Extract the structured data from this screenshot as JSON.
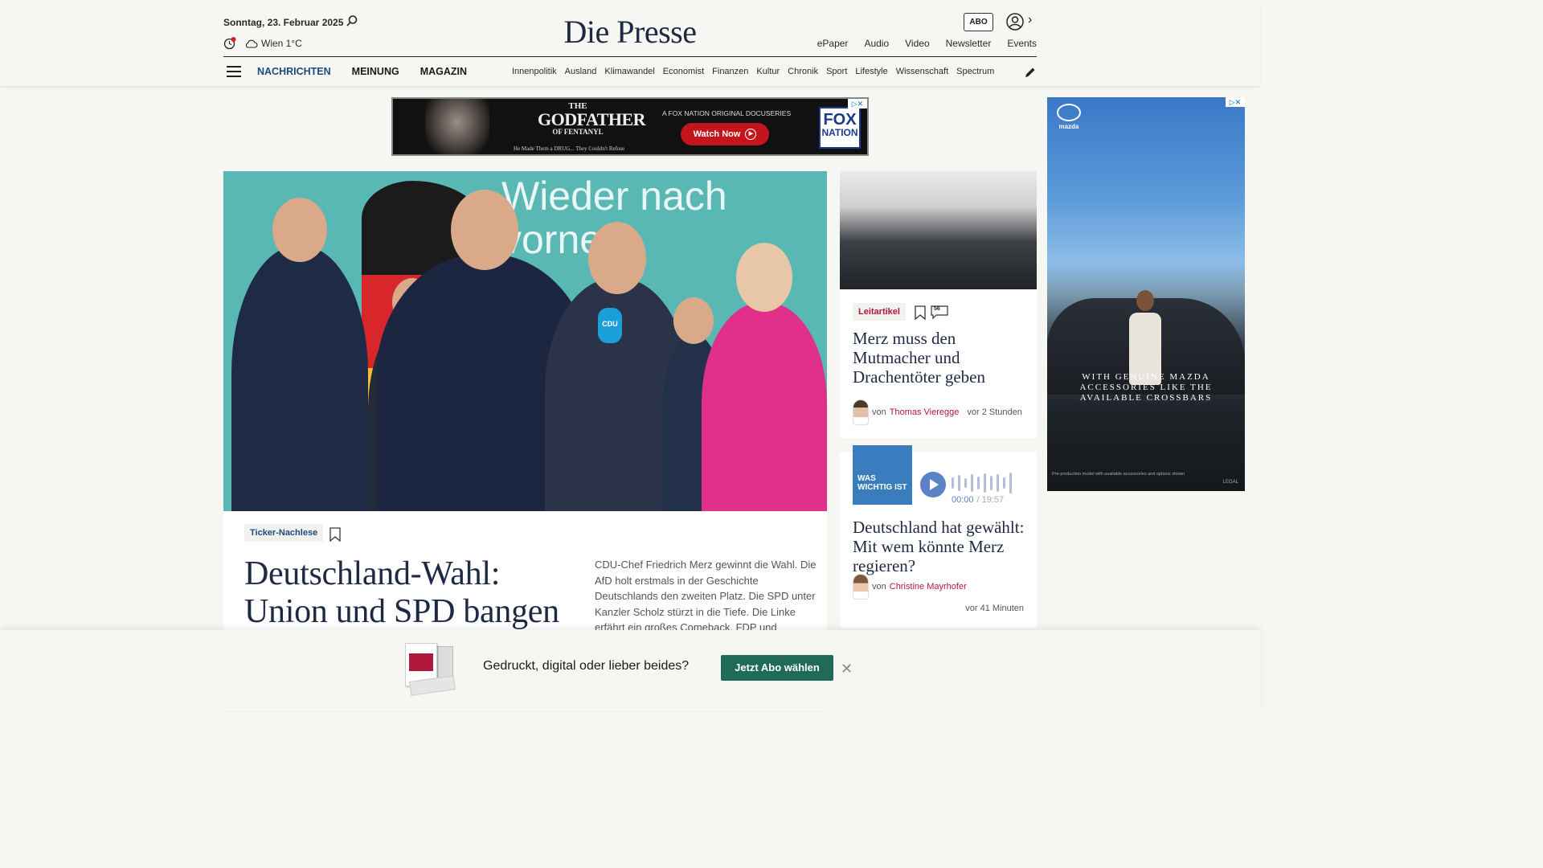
{
  "header": {
    "date": "Sonntag, 23. Februar 2025",
    "weather": "Wien 1°C",
    "logo": "Die Presse",
    "abo": "ABO",
    "top_links": [
      "ePaper",
      "Audio",
      "Video",
      "Newsletter",
      "Events"
    ]
  },
  "nav": {
    "main": [
      "NACHRICHTEN",
      "MEINUNG",
      "MAGAZIN"
    ],
    "sub": [
      "Innenpolitik",
      "Ausland",
      "Klimawandel",
      "Economist",
      "Finanzen",
      "Kultur",
      "Chronik",
      "Sport",
      "Lifestyle",
      "Wissenschaft",
      "Spectrum"
    ]
  },
  "ad_top": {
    "title_l1": "THE",
    "title_l2": "GODFATHER",
    "title_l3": "OF FENTANYL",
    "tagline": "He Made Them a DRUG... They Couldn't Refuse",
    "subtitle": "A FOX NATION ORIGINAL DOCUSERIES",
    "cta": "Watch Now",
    "brand_l1": "FOX",
    "brand_l2": "NATION"
  },
  "ad_side": {
    "brand": "mazda",
    "headline": "WITH GENUINE MAZDA ACCESSORIES LIKE THE AVAILABLE CROSSBARS",
    "fine_print": "Pre-production model with available accessories and options shown",
    "legal": "LEGAL"
  },
  "hero": {
    "image_text": "Wieder nach vorne",
    "mic_label": "CDU",
    "tag": "Ticker-Nachlese",
    "title": "Deutschland-Wahl: Union und SPD bangen",
    "teaser": "CDU-Chef Friedrich Merz gewinnt die Wahl. Die AfD holt erstmals in der Geschichte Deutschlands den zweiten Platz. Die SPD unter Kanzler Scholz stürzt in die Tiefe. Die Linke erfährt ein großes Comeback. FDP und"
  },
  "card1": {
    "tag": "Leitartikel",
    "comments": "56",
    "title": "Merz muss den Mutmacher und Drachentöter geben",
    "by": "von",
    "author": "Thomas Vieregge",
    "time": "vor 2 Stunden"
  },
  "card2": {
    "podcast_label": "WAS WICHTIG IST",
    "time_current": "00:00",
    "time_total": "/ 19:57",
    "title": "Deutschland hat gewählt: Mit wem könnte Merz regieren?",
    "by": "von",
    "author": "Christine Mayrhofer",
    "time": "vor 41 Minuten"
  },
  "banner": {
    "text": "Gedruckt, digital oder lieber beides?",
    "cta": "Jetzt Abo wählen"
  }
}
